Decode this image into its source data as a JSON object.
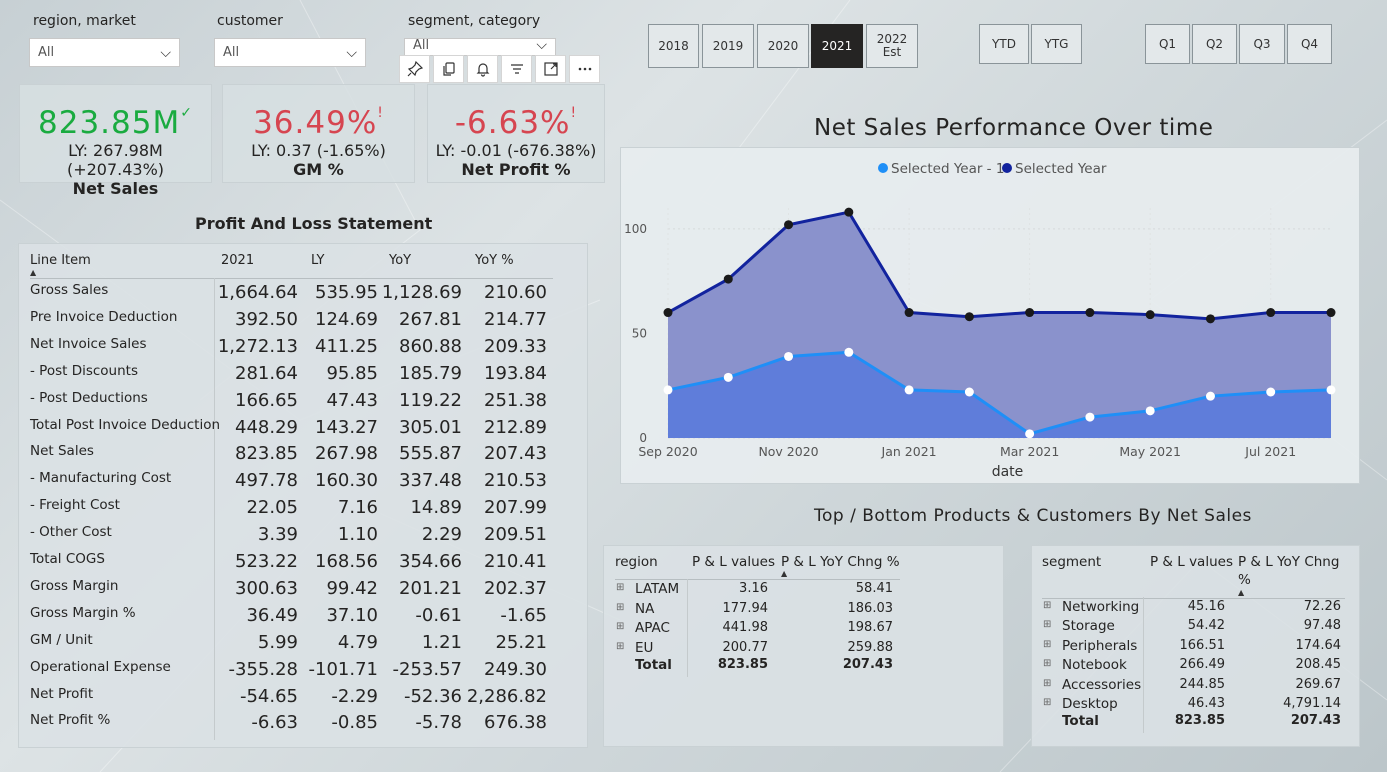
{
  "slicers": {
    "region": {
      "label": "region, market",
      "value": "All"
    },
    "customer": {
      "label": "customer",
      "value": "All"
    },
    "segment": {
      "label": "segment, category",
      "value": "All"
    }
  },
  "years": [
    "2018",
    "2019",
    "2020",
    "2021",
    "2022 Est"
  ],
  "selected_year": "2021",
  "period_buttons": [
    "YTD",
    "YTG"
  ],
  "quarters": [
    "Q1",
    "Q2",
    "Q3",
    "Q4"
  ],
  "kpis": {
    "net_sales": {
      "value": "823.85M",
      "mark": "✓",
      "ly": "LY: 267.98M (+207.43%)",
      "title": "Net Sales"
    },
    "gm": {
      "value": "36.49%",
      "mark": "!",
      "ly": "LY: 0.37 (-1.65%)",
      "title": "GM %"
    },
    "net_profit": {
      "value": "-6.63%",
      "mark": "!",
      "ly": "LY: -0.01 (-676.38%)",
      "title": "Net Profit %"
    }
  },
  "pl": {
    "title": "Profit And Loss Statement",
    "headers": [
      "Line Item",
      "2021",
      "LY",
      "YoY",
      "YoY %"
    ],
    "rows": [
      {
        "label": "Gross Sales",
        "v": [
          "1,664.64",
          "535.95",
          "1,128.69",
          "210.60"
        ]
      },
      {
        "label": "Pre Invoice Deduction",
        "v": [
          "392.50",
          "124.69",
          "267.81",
          "214.77"
        ]
      },
      {
        "label": "Net Invoice Sales",
        "v": [
          "1,272.13",
          "411.25",
          "860.88",
          "209.33"
        ]
      },
      {
        "label": "- Post Discounts",
        "v": [
          "281.64",
          "95.85",
          "185.79",
          "193.84"
        ]
      },
      {
        "label": "- Post Deductions",
        "v": [
          "166.65",
          "47.43",
          "119.22",
          "251.38"
        ]
      },
      {
        "label": "Total Post Invoice Deduction",
        "v": [
          "448.29",
          "143.27",
          "305.01",
          "212.89"
        ]
      },
      {
        "label": "Net Sales",
        "v": [
          "823.85",
          "267.98",
          "555.87",
          "207.43"
        ]
      },
      {
        "label": "- Manufacturing Cost",
        "v": [
          "497.78",
          "160.30",
          "337.48",
          "210.53"
        ]
      },
      {
        "label": "- Freight Cost",
        "v": [
          "22.05",
          "7.16",
          "14.89",
          "207.99"
        ]
      },
      {
        "label": "- Other Cost",
        "v": [
          "3.39",
          "1.10",
          "2.29",
          "209.51"
        ]
      },
      {
        "label": "Total COGS",
        "v": [
          "523.22",
          "168.56",
          "354.66",
          "210.41"
        ]
      },
      {
        "label": "Gross Margin",
        "v": [
          "300.63",
          "99.42",
          "201.21",
          "202.37"
        ]
      },
      {
        "label": "Gross Margin %",
        "v": [
          "36.49",
          "37.10",
          "-0.61",
          "-1.65"
        ]
      },
      {
        "label": "GM / Unit",
        "v": [
          "5.99",
          "4.79",
          "1.21",
          "25.21"
        ]
      },
      {
        "label": "Operational Expense",
        "v": [
          "-355.28",
          "-101.71",
          "-253.57",
          "249.30"
        ]
      },
      {
        "label": "Net Profit",
        "v": [
          "-54.65",
          "-2.29",
          "-52.36",
          "2,286.82"
        ]
      },
      {
        "label": "Net Profit %",
        "v": [
          "-6.63",
          "-0.85",
          "-5.78",
          "676.38"
        ]
      }
    ]
  },
  "chart_title": "Net Sales Performance Over time",
  "chart_data": {
    "type": "area",
    "title": "Net Sales Performance Over time",
    "xlabel": "date",
    "ylabel": "",
    "ylim": [
      0,
      110
    ],
    "yticks": [
      0,
      50,
      100
    ],
    "x": [
      "Sep 2020",
      "Oct 2020",
      "Nov 2020",
      "Dec 2020",
      "Jan 2021",
      "Feb 2021",
      "Mar 2021",
      "Apr 2021",
      "May 2021",
      "Jun 2021",
      "Jul 2021",
      "Aug 2021"
    ],
    "xtick_labels": [
      "Sep 2020",
      "Nov 2020",
      "Jan 2021",
      "Mar 2021",
      "May 2021",
      "Jul 2021"
    ],
    "legend": "top-center",
    "series": [
      {
        "name": "Selected Year - 1",
        "color": "#1f8ff7",
        "values": [
          23,
          29,
          39,
          41,
          23,
          22,
          2,
          10,
          13,
          20,
          22,
          23
        ]
      },
      {
        "name": "Selected Year",
        "color": "#12239e",
        "values": [
          60,
          76,
          102,
          108,
          60,
          58,
          60,
          60,
          59,
          57,
          60,
          60
        ]
      }
    ]
  },
  "bottom_title": "Top / Bottom Products & Customers By Net Sales",
  "region_table": {
    "headers": [
      "region",
      "P & L values",
      "P & L YoY Chng %"
    ],
    "rows": [
      {
        "label": "LATAM",
        "v": "3.16",
        "c": "58.41"
      },
      {
        "label": "NA",
        "v": "177.94",
        "c": "186.03"
      },
      {
        "label": "APAC",
        "v": "441.98",
        "c": "198.67"
      },
      {
        "label": "EU",
        "v": "200.77",
        "c": "259.88"
      }
    ],
    "total": {
      "label": "Total",
      "v": "823.85",
      "c": "207.43"
    }
  },
  "segment_table": {
    "headers": [
      "segment",
      "P & L values",
      "P & L YoY Chng",
      "%"
    ],
    "rows": [
      {
        "label": "Networking",
        "v": "45.16",
        "c": "72.26"
      },
      {
        "label": "Storage",
        "v": "54.42",
        "c": "97.48"
      },
      {
        "label": "Peripherals",
        "v": "166.51",
        "c": "174.64"
      },
      {
        "label": "Notebook",
        "v": "266.49",
        "c": "208.45"
      },
      {
        "label": "Accessories",
        "v": "244.85",
        "c": "269.67"
      },
      {
        "label": "Desktop",
        "v": "46.43",
        "c": "4,791.14"
      }
    ],
    "total": {
      "label": "Total",
      "v": "823.85",
      "c": "207.43"
    }
  },
  "icons": [
    "pin-icon",
    "copy-icon",
    "bell-icon",
    "filter-icon",
    "focus-mode-icon",
    "more-options-icon"
  ]
}
